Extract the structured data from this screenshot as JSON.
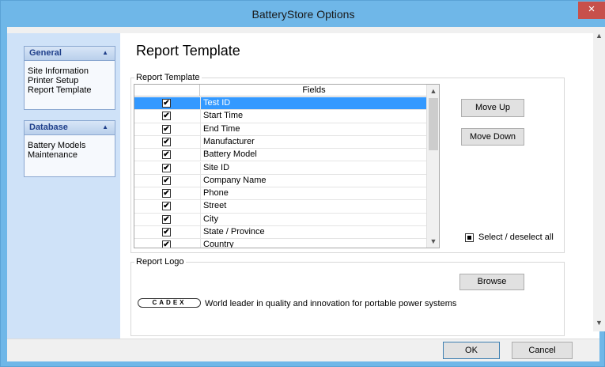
{
  "window": {
    "title": "BatteryStore Options",
    "close_glyph": "×"
  },
  "sidebar": {
    "sections": [
      {
        "header": "General",
        "chevron": "▲",
        "items": [
          "Site Information",
          "Printer Setup",
          "Report Template"
        ]
      },
      {
        "header": "Database",
        "chevron": "▲",
        "items": [
          "Battery Models",
          "Maintenance"
        ]
      }
    ]
  },
  "main": {
    "heading": "Report Template",
    "template_group_label": "Report Template",
    "grid": {
      "column_header": "Fields",
      "selected_index": 0,
      "rows": [
        {
          "field": "Test ID",
          "checked": true
        },
        {
          "field": "Start Time",
          "checked": true
        },
        {
          "field": "End Time",
          "checked": true
        },
        {
          "field": "Manufacturer",
          "checked": true
        },
        {
          "field": "Battery Model",
          "checked": true
        },
        {
          "field": "Site ID",
          "checked": true
        },
        {
          "field": "Company Name",
          "checked": true
        },
        {
          "field": "Phone",
          "checked": true
        },
        {
          "field": "Street",
          "checked": true
        },
        {
          "field": "City",
          "checked": true
        },
        {
          "field": "State / Province",
          "checked": true
        },
        {
          "field": "Country",
          "checked": true
        }
      ],
      "check_glyph": "✔",
      "scroll_up_glyph": "▲",
      "scroll_down_glyph": "▼"
    },
    "move_up_label": "Move Up",
    "move_down_label": "Move Down",
    "select_all_label": "Select / deselect all",
    "logo_group_label": "Report Logo",
    "browse_label": "Browse",
    "logo_text": "CADEX",
    "tagline": "World leader in quality and innovation for portable power systems"
  },
  "footer": {
    "ok_label": "OK",
    "cancel_label": "Cancel"
  },
  "outer_scroll": {
    "up_glyph": "▲",
    "down_glyph": "▼"
  },
  "colors": {
    "titlebar": "#6fb7e8",
    "sidebar_bg": "#cfe2f8",
    "selection": "#3399ff",
    "close": "#c7504b"
  }
}
